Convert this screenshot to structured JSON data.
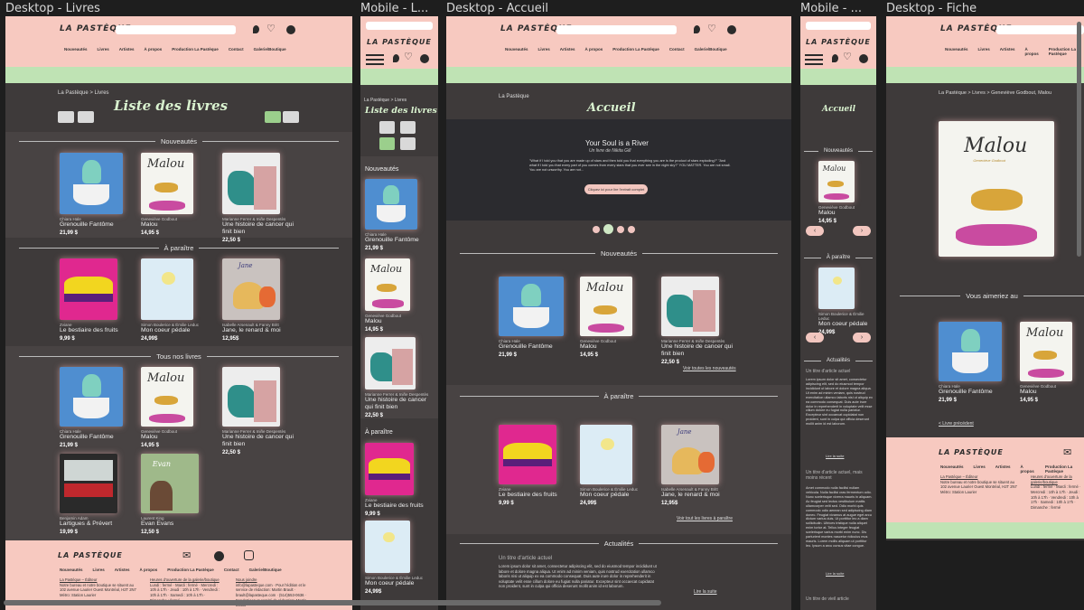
{
  "frame_labels": {
    "desktop_books": "Desktop - Livres",
    "mobile_books": "Mobile - L...",
    "desktop_home": "Desktop - Accueil",
    "mobile_home": "Mobile - ...",
    "desktop_sheet": "Desktop - Fiche"
  },
  "brand": {
    "logo": "LA PASTÈQUE"
  },
  "nav": [
    "Nouveautés",
    "Livres",
    "Artistes",
    "À propos",
    "Production La Pastèque",
    "Contact",
    "Galerie/Boutique"
  ],
  "books_page": {
    "breadcrumb": "La Pastèque > Livres",
    "title": "Liste des livres",
    "sections": {
      "new": "Nouveautés",
      "upcoming": "À paraître",
      "all": "Tous nos livres"
    }
  },
  "books": {
    "grenouille": {
      "author": "Chiara Hale",
      "title": "Grenouille Fantôme",
      "price": "21,99 $"
    },
    "malou": {
      "author": "Geneviève Godbout",
      "title": "Malou",
      "price": "14,95 $"
    },
    "cancer": {
      "author": "Marianne Ferrer & Iniñe Despentès",
      "title": "Une histoire de cancer qui finit bien",
      "price": "22,50 $"
    },
    "bestiaire": {
      "author": "Zviane",
      "title": "Le bestiaire des fruits",
      "price": "9,99 $"
    },
    "coeur": {
      "author": "Simon Boulerice & Émilie Leduc",
      "title": "Mon coeur pédale",
      "price": "24,99$"
    },
    "jane": {
      "author": "Isabelle Arsenault & Fanny Britt",
      "title": "Jane, le renard & moi",
      "price": "12,95$"
    },
    "lartigues": {
      "author": "Benjamin Adam",
      "title": "Lartigues & Prévert",
      "price": "19,99 $"
    },
    "evan": {
      "author": "Laurent King",
      "title": "Evan Evans",
      "price": "12,50 $"
    }
  },
  "home_page": {
    "breadcrumb": "La Pastèque",
    "title": "Accueil",
    "hero_title": "Your Soul is a River",
    "hero_sub": "Un livre de Nikita Gill",
    "hero_quote": "\"What if I told you that you are made up of stars and then told you that everything you are is the product of stars exploding?\" \"And what if I told you that every part of you comes from every stars that you ever see in the night sky?\" YOU MATTER. You are not small. You are not unworthy. You are not...",
    "hero_button": "Cliquez ici pour lire l'extrait complet",
    "see_new": "Voir toutes les nouveautés",
    "see_upcoming": "Voir tout les livres à paraître",
    "news": "Actualités",
    "article_title": "Un titre d'article actuel",
    "article_text": "Lorem ipsum dolor sit amet, consectetur adipiscing elit, sed do eiusmod tempor incididunt ut labore et dolore magna aliqua. Ut enim ad minim veniam, quis nostrud exercitation ullamco laboris nisi ut aliquip ex ea commodo consequat. Duis aute irure dolor in reprehenderit in voluptate velit esse cillum dolore eu fugiat nulla pariatur. Excepteur sint occaecat cupidatat non proident, sunt in culpa qui officia deserunt mollit anim id est laborum.",
    "read_more": "Lire la suite"
  },
  "mobile_home": {
    "article2_title": "Un titre d'article actuel, mais moins récent",
    "article2_text": "Amet commodo nulla facilisi nullam vehicula. Nulla facilisi cras fermentum odio. Nunc scelerisque viverra mauris in aliquam. Ac feugiat sed lectus vestibulum mattis ullamcorper velit sed. Odio morbi quis commodo odio aenean sed adipiscing diam donec. Feugiat vivamus at augue eget arcu dictum varius duis. Ut porttitor leo a diam sollicitudin. Ultrices tristique nulla aliquet enim tortor at. Tellus integer feugiat scelerisque varius morbi enim nunc. Dis parturient montes nascetur ridiculus mus mauris. Lorem mollis aliquam ut porttitor leo. Ipsum a arcu cursus vitae congue.",
    "article3_title": "Un titre de vieil article"
  },
  "sheet_page": {
    "breadcrumb": "La Pastèque > Livres > Geneviève Godbout, Malou",
    "title": "Malou",
    "cover_author": "Geneviève Godbout",
    "also_like": "Vous aimeriez au",
    "prev": "< Livre précédent"
  },
  "footer": {
    "publisher": "La Pastèque – Éditeur",
    "address": "Notre bureau et notre boutique se situent au 102 avenue Laurier Ouest Montréal, H2T 2N7",
    "metro": "Métro: Station Laurier",
    "hours_title": "Heures d'ouverture de la galerie/boutique",
    "hours": "Lundi : fermé · Mardi : fermé · Mercredi : 10h à 17h · Jeudi : 10h à 17h · Vendredi : 10h à 17h · Samedi : 10h à 17h · Dimanche : fermé",
    "contact_title": "Nous joindre",
    "contact": "info@lapasteque.com · Pour l'édition et le service de rédaction: Martin Brault · brault@lapasteque.com · (514)553-0636 · Fondatrices et comité de rédaction: Martin Brault",
    "social": [
      "mail-icon",
      "facebook-icon",
      "instagram-icon"
    ]
  },
  "colors": {
    "header_pink": "#f7c9c0",
    "strip_green": "#bfe3b4",
    "page_dark": "#3e3a3a",
    "title_mint": "#d9f2cf"
  }
}
